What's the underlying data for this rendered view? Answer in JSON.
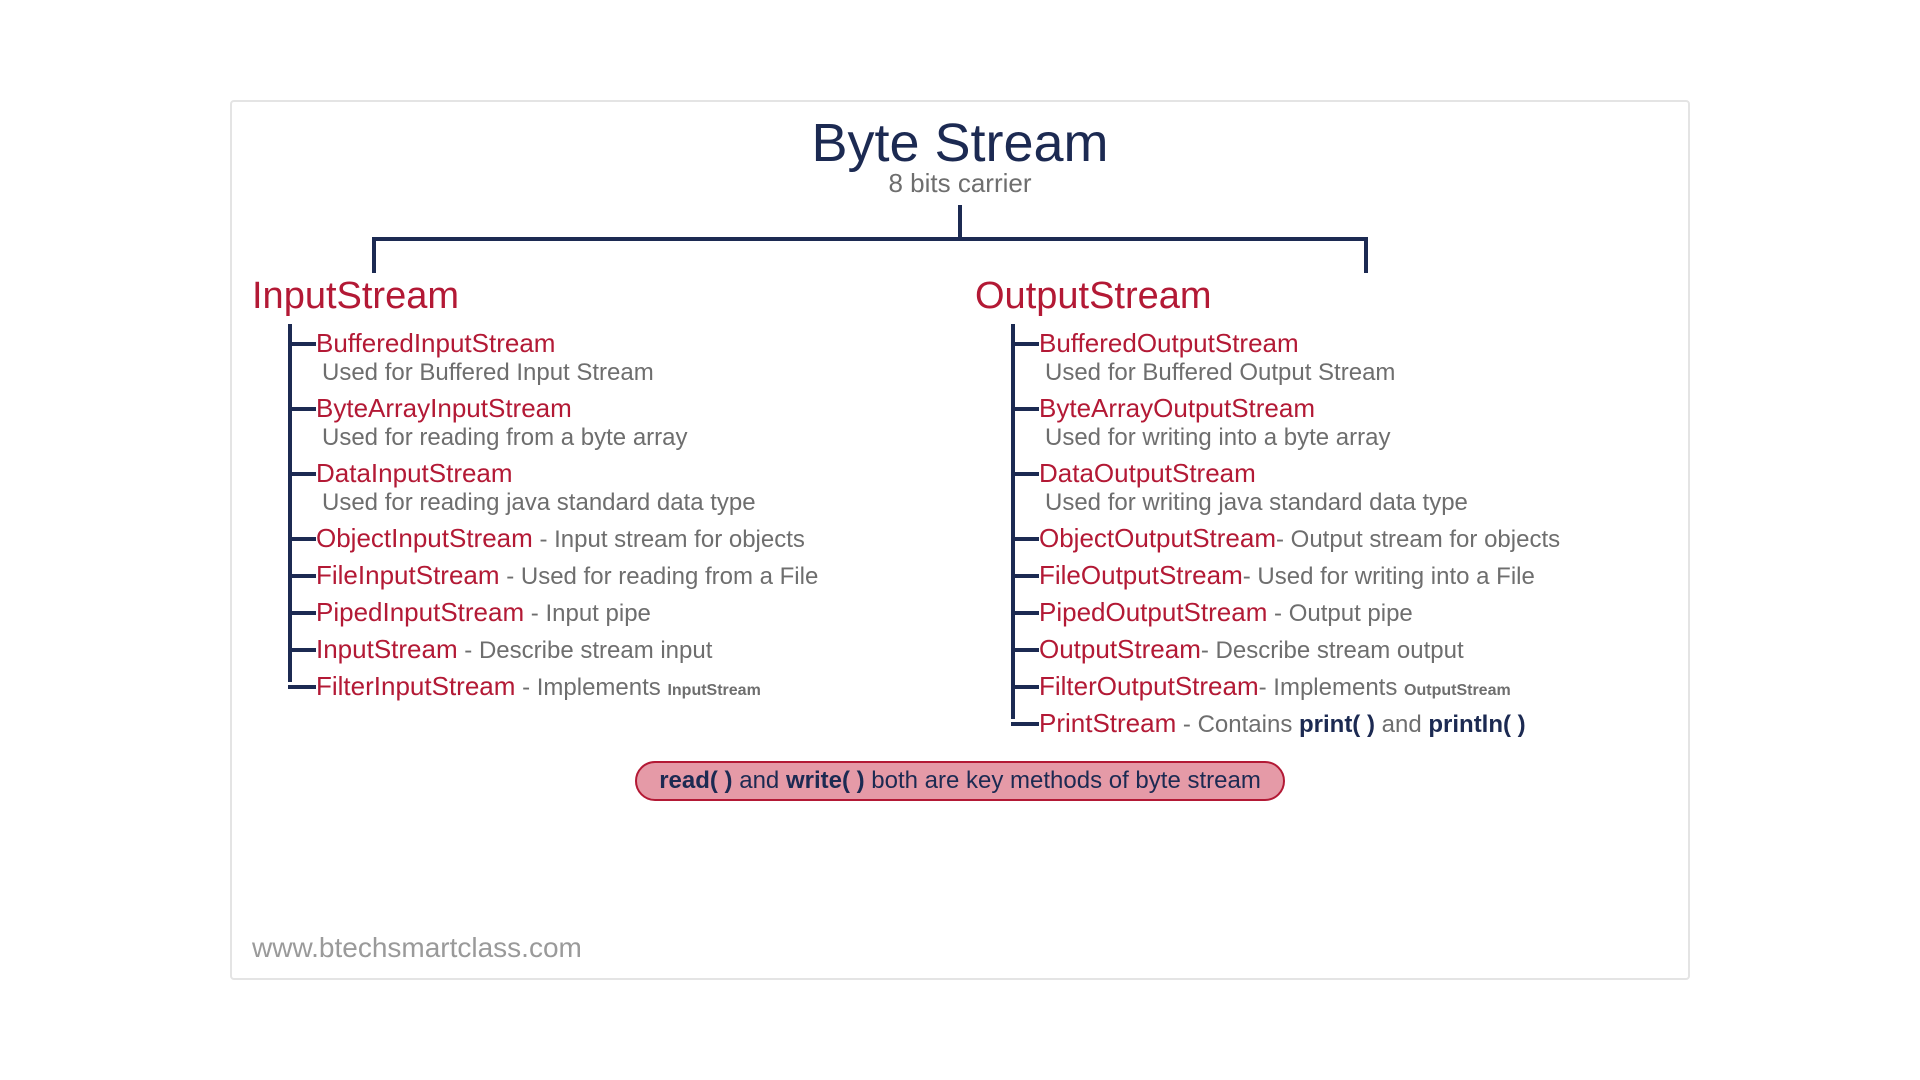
{
  "title": "Byte Stream",
  "subtitle": "8 bits carrier",
  "input": {
    "heading": "InputStream",
    "items": [
      {
        "name": "BufferedInputStream",
        "desc": "Used for Buffered Input Stream",
        "layout": "block"
      },
      {
        "name": "ByteArrayInputStream",
        "desc": "Used for reading from a byte array",
        "layout": "block"
      },
      {
        "name": "DataInputStream",
        "desc": "Used for reading java standard data type",
        "layout": "block"
      },
      {
        "name": "ObjectInputStream",
        "sep": "  - ",
        "desc": "Input stream for objects",
        "layout": "inline"
      },
      {
        "name": "FileInputStream",
        "sep": " - ",
        "desc": "Used for reading from a File",
        "layout": "inline"
      },
      {
        "name": "PipedInputStream",
        "sep": " - ",
        "desc": "Input pipe",
        "layout": "inline"
      },
      {
        "name": "InputStream",
        "sep": "  - ",
        "desc": "Describe stream input",
        "layout": "inline"
      },
      {
        "name": "FilterInputStream",
        "sep": "  - ",
        "desc_pre": "Implements ",
        "desc_bold": "InputStream",
        "layout": "inline-bold"
      }
    ]
  },
  "output": {
    "heading": "OutputStream",
    "items": [
      {
        "name": "BufferedOutputStream",
        "desc": "Used for Buffered Output Stream",
        "layout": "block"
      },
      {
        "name": "ByteArrayOutputStream",
        "desc": "Used for writing into a byte array",
        "layout": "block"
      },
      {
        "name": "DataOutputStream",
        "desc": "Used for writing java standard data type",
        "layout": "block"
      },
      {
        "name": "ObjectOutputStream",
        "sep": "- ",
        "desc": "Output stream for objects",
        "layout": "inline"
      },
      {
        "name": "FileOutputStream",
        "sep": "- ",
        "desc": "Used for writing into a File",
        "layout": "inline"
      },
      {
        "name": "PipedOutputStream",
        "sep": " - ",
        "desc": "Output pipe",
        "layout": "inline"
      },
      {
        "name": "OutputStream",
        "sep": "- ",
        "desc": "Describe stream output",
        "layout": "inline"
      },
      {
        "name": "FilterOutputStream",
        "sep": "- ",
        "desc_pre": "Implements ",
        "desc_bold": "OutputStream",
        "layout": "inline-bold"
      },
      {
        "name": "PrintStream",
        "sep": "   - ",
        "desc_parts": [
          "Contains ",
          "print( )",
          " and ",
          "println( )"
        ],
        "layout": "inline-print"
      }
    ]
  },
  "pill": {
    "b1": "read( )",
    "mid1": " and ",
    "b2": "write( )",
    "tail": " both are key methods of byte stream"
  },
  "watermark": "www.btechsmartclass.com"
}
